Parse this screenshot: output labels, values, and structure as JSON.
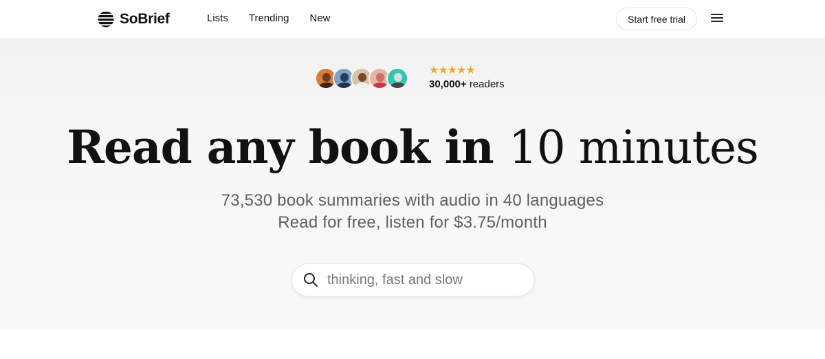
{
  "brand": {
    "name": "SoBrief"
  },
  "nav": {
    "items": [
      {
        "label": "Lists"
      },
      {
        "label": "Trending"
      },
      {
        "label": "New"
      }
    ],
    "cta_label": "Start free trial",
    "menu_icon": "hamburger-menu-icon"
  },
  "social_proof": {
    "avatar_count": 5,
    "rating_stars": 5,
    "stars_text": "★★★★★",
    "readers_count": "30,000+",
    "readers_suffix": "readers"
  },
  "hero": {
    "headline_bold": "Read any book in",
    "headline_light": "10 minutes",
    "subline_1": "73,530 book summaries with audio in 40 languages",
    "subline_2": "Read for free, listen for $3.75/month"
  },
  "search": {
    "placeholder": "thinking, fast and slow",
    "value": "",
    "icon": "search-icon"
  },
  "colors": {
    "accent_star": "#f5a623",
    "underline_highlight": "#f8e7a8",
    "hero_background": "#f5f5f5"
  }
}
